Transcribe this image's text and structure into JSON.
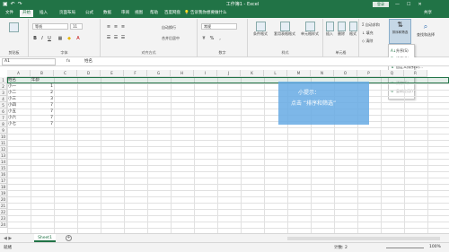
{
  "titlebar": {
    "title": "工作簿1 - Excel",
    "login": "登录",
    "qat_icons": [
      "save-icon",
      "undo-icon",
      "redo-icon"
    ],
    "brand_color": "#217346"
  },
  "watermark": "秒懂视频",
  "tabs": {
    "items": [
      "文件",
      "开始",
      "插入",
      "页面布局",
      "公式",
      "数据",
      "审阅",
      "视图",
      "帮助",
      "百度网盘"
    ],
    "active_index": 1,
    "tell_me": "告诉我你想要做什么",
    "share": "共享"
  },
  "ribbon": {
    "groups": [
      "剪贴板",
      "字体",
      "对齐方式",
      "数字",
      "样式",
      "单元格",
      "编辑"
    ],
    "font_name": "等线",
    "font_size": "11",
    "number_format": "常规",
    "wrap_text": "自动换行",
    "merge_center": "合并后居中",
    "cond_format": "条件格式",
    "table_format": "套用表格格式",
    "cell_styles": "单元格样式",
    "insert": "插入",
    "delete": "删除",
    "format": "格式",
    "autosum": "自动求和",
    "fill": "填充",
    "clear": "清除",
    "sort_filter": "排序和筛选",
    "find_select": "查找和选择"
  },
  "sort_menu": {
    "items": [
      {
        "label": "升序(S)",
        "disabled": false
      },
      {
        "label": "降序(O)",
        "disabled": false
      },
      {
        "label": "自定义排序(U)...",
        "disabled": false
      },
      {
        "label": "筛选(F)",
        "disabled": false
      },
      {
        "label": "清除(C)",
        "disabled": true
      },
      {
        "label": "重新应用(Y)",
        "disabled": true
      }
    ]
  },
  "formula_bar": {
    "name_box": "A1",
    "fx": "fx",
    "value": "姓名"
  },
  "grid": {
    "columns": [
      "A",
      "B",
      "C",
      "D",
      "E",
      "F",
      "G",
      "H",
      "I",
      "J",
      "K",
      "L",
      "M",
      "N",
      "O",
      "P",
      "Q",
      "R"
    ],
    "rows": [
      "1",
      "2",
      "3",
      "4",
      "5",
      "6",
      "7",
      "8",
      "9",
      "10",
      "11",
      "12",
      "13",
      "14",
      "15",
      "16",
      "17",
      "18",
      "19",
      "20",
      "21",
      "22",
      "23",
      "24"
    ],
    "data": [
      [
        "姓名",
        "年龄"
      ],
      [
        "小一",
        "1"
      ],
      [
        "小二",
        "2"
      ],
      [
        "小三",
        "3"
      ],
      [
        "小四",
        "7"
      ],
      [
        "小五",
        "7"
      ],
      [
        "小六",
        "7"
      ],
      [
        "小七",
        "7"
      ]
    ]
  },
  "callout": {
    "line1": "小提示：",
    "line2": "点击 “排序和筛选”",
    "color": "#66aae4"
  },
  "sheets": {
    "tabs": [
      "Sheet1"
    ],
    "add_icon": "plus-icon"
  },
  "status": {
    "ready": "就绪",
    "count": "计数: 2",
    "zoom": "100%"
  }
}
